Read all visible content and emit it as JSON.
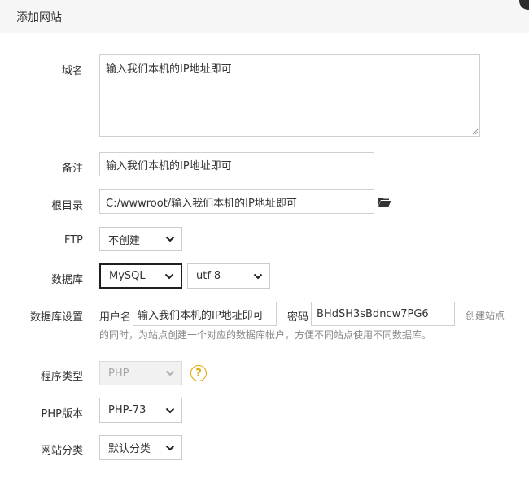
{
  "dialog": {
    "title": "添加网站"
  },
  "form": {
    "domain": {
      "label": "域名",
      "value": "输入我们本机的IP地址即可"
    },
    "remark": {
      "label": "备注",
      "value": "输入我们本机的IP地址即可"
    },
    "root_dir": {
      "label": "根目录",
      "value": "C:/wwwroot/输入我们本机的IP地址即可",
      "browse_icon": "folder-open-icon"
    },
    "ftp": {
      "label": "FTP",
      "value": "不创建"
    },
    "database": {
      "label": "数据库",
      "type_value": "MySQL",
      "charset_value": "utf-8"
    },
    "db_settings": {
      "label": "数据库设置",
      "username_label": "用户名",
      "username_value": "输入我们本机的IP地址即可",
      "password_label": "密码",
      "password_value": "BHdSH3sBdncw7PG6",
      "hint_line1": "创建站点",
      "hint_line2": "的同时，为站点创建一个对应的数据库帐户，方便不同站点使用不同数据库。"
    },
    "program_type": {
      "label": "程序类型",
      "value": "PHP",
      "help_icon": "help-circle-icon",
      "help_glyph": "?"
    },
    "php_version": {
      "label": "PHP版本",
      "value": "PHP-73"
    },
    "site_category": {
      "label": "网站分类",
      "value": "默认分类"
    }
  },
  "colors": {
    "accent_help": "#e0a600",
    "active_border": "#1f1f1f",
    "disabled_bg": "#f1f1f1"
  }
}
